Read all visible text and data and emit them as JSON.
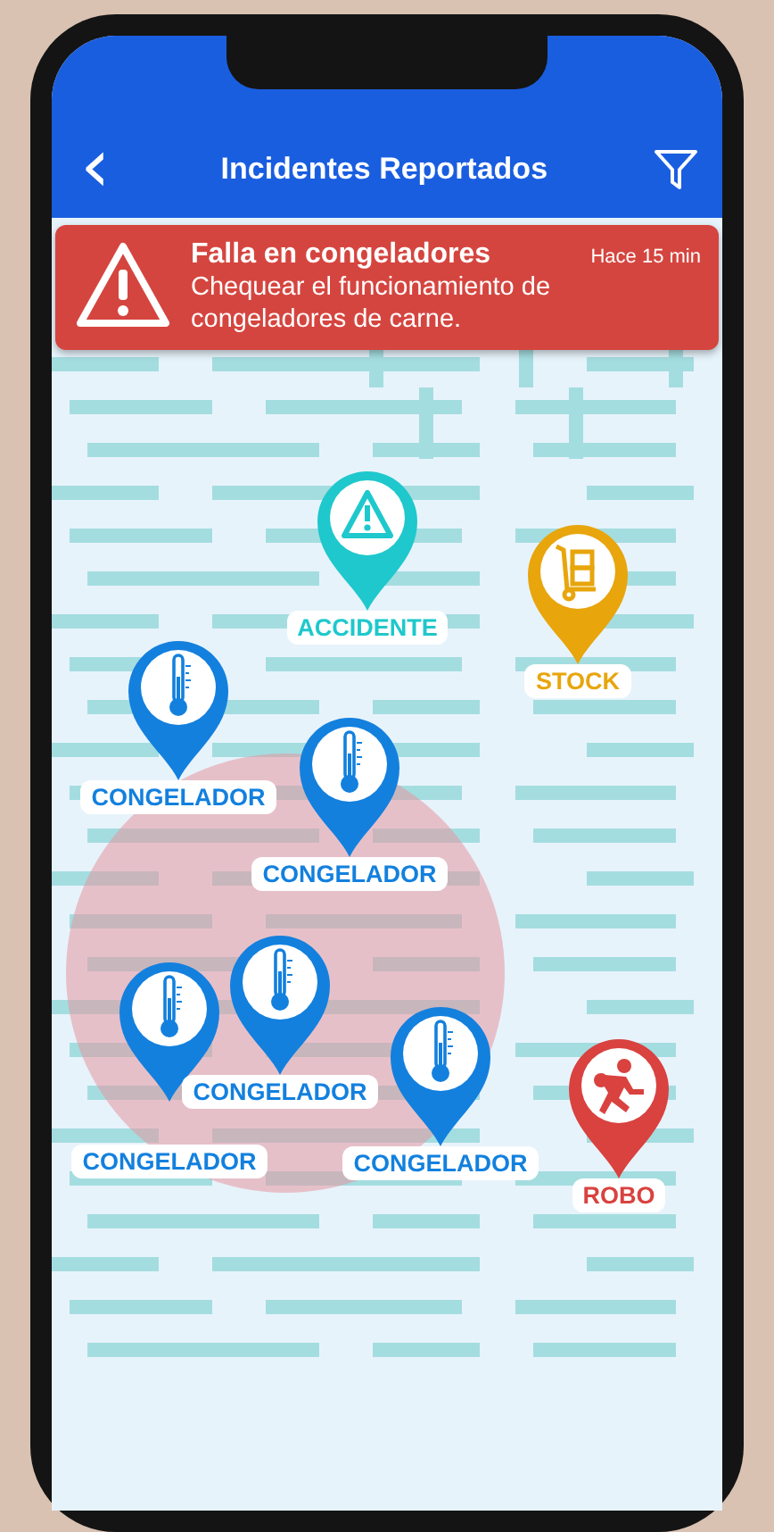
{
  "header": {
    "back": "‹",
    "title": "Incidentes Reportados"
  },
  "alert": {
    "title": "Falla en congeladores",
    "time": "Hace 15 min",
    "message": "Chequear el funcionamiento de congeladores de carne."
  },
  "pins": [
    {
      "kind": "accident",
      "label": "ACCIDENTE",
      "color": "#1ec8cc"
    },
    {
      "kind": "stock",
      "label": "STOCK",
      "color": "#e8a50c"
    },
    {
      "kind": "freezer",
      "label": "CONGELADOR",
      "color": "#1380de"
    },
    {
      "kind": "freezer",
      "label": "CONGELADOR",
      "color": "#1380de"
    },
    {
      "kind": "freezer",
      "label": "CONGELADOR",
      "color": "#1380de"
    },
    {
      "kind": "freezer",
      "label": "CONGELADOR",
      "color": "#1380de"
    },
    {
      "kind": "freezer",
      "label": "CONGELADOR",
      "color": "#1380de"
    },
    {
      "kind": "theft",
      "label": "ROBO",
      "color": "#d9423f"
    }
  ]
}
